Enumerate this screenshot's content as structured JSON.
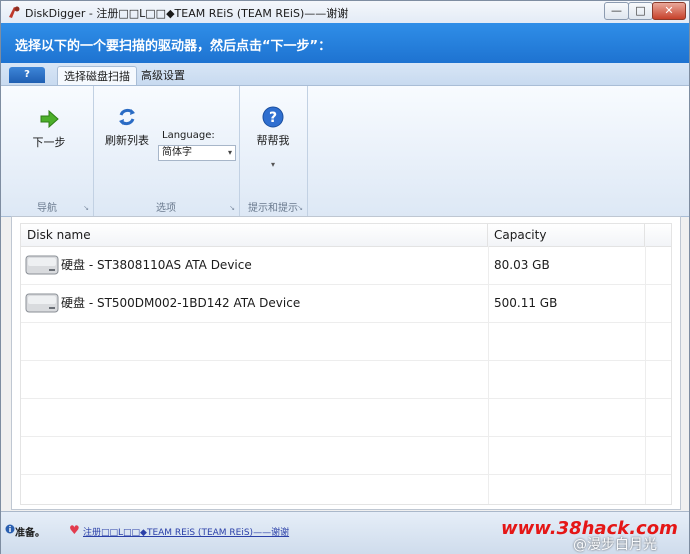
{
  "window": {
    "title": "DiskDigger - 注册□□L□□◆TEAM REiS (TEAM REiS)——谢谢",
    "buttons": {
      "minimize": "—",
      "maximize": "□",
      "close": "✕"
    }
  },
  "banner": {
    "text": "选择以下的一个要扫描的驱动器，然后点击“下一步”："
  },
  "ribbon": {
    "app_tab": "?",
    "tabs": [
      "选择磁盘扫描",
      "高级设置"
    ],
    "groups": {
      "nav": {
        "label": "导航",
        "next_label": "下一步"
      },
      "options": {
        "label": "选项",
        "refresh_label": "刷新列表",
        "language_label": "Language:",
        "language_value": "简体字"
      },
      "help": {
        "label": "提示和提示",
        "help_label": "帮帮我",
        "help_caret": "▾"
      }
    },
    "launcher_glyph": "↘"
  },
  "list": {
    "columns": [
      "Disk name",
      "Capacity"
    ],
    "rows": [
      {
        "name": "硬盘 - ST3808110AS ATA Device",
        "capacity": "80.03 GB"
      },
      {
        "name": "硬盘 - ST500DM002-1BD142 ATA Device",
        "capacity": "500.11 GB"
      }
    ]
  },
  "status": {
    "ready": "准备。",
    "link": "注册□□L□□◆TEAM REiS (TEAM REiS)——谢谢"
  },
  "watermark": {
    "site": "www.38hack.com",
    "user": "@漫步白月光"
  },
  "colors": {
    "banner": "#1e73d1",
    "accent": "#2f8ee8",
    "watermark": "#e51616"
  }
}
